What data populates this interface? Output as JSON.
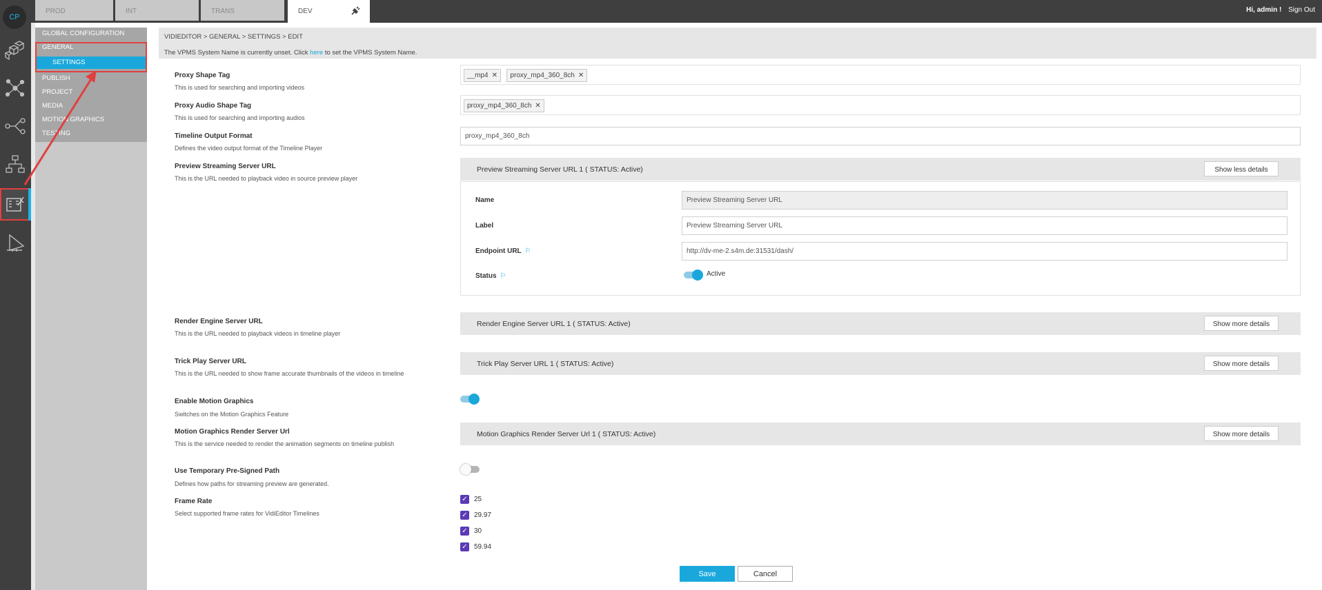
{
  "app": {
    "logo": "CP",
    "user_greeting": "Hi, admin !",
    "sign_out": "Sign Out"
  },
  "env_tabs": [
    {
      "label": "PROD"
    },
    {
      "label": "INT"
    },
    {
      "label": "TRANS"
    },
    {
      "label": "DEV",
      "icon": "plug-icon"
    }
  ],
  "rail_icons": [
    "cubes-icon",
    "network-icon",
    "workflow-icon",
    "hierarchy-icon",
    "vidieditor-icon",
    "ruler-icon"
  ],
  "nav": {
    "items": [
      {
        "label": "GLOBAL CONFIGURATION"
      },
      {
        "label": "GENERAL"
      },
      {
        "label": "SETTINGS"
      },
      {
        "label": "PUBLISH"
      },
      {
        "label": "PROJECT"
      },
      {
        "label": "MEDIA"
      },
      {
        "label": "MOTION GRAPHICS"
      },
      {
        "label": "TESTING"
      }
    ]
  },
  "breadcrumb": "VIDIEDITOR > GENERAL > SETTINGS > EDIT",
  "notice": {
    "before": "The VPMS System Name is currently unset. Click ",
    "link": "here",
    "after": " to set the VPMS System Name."
  },
  "fields": {
    "proxy_shape": {
      "label": "Proxy Shape Tag",
      "desc": "This is used for searching and importing videos",
      "tags": [
        "__mp4",
        "proxy_mp4_360_8ch"
      ]
    },
    "proxy_audio": {
      "label": "Proxy Audio Shape Tag",
      "desc": "This is used for searching and importing audios",
      "tags": [
        "proxy_mp4_360_8ch"
      ]
    },
    "timeline_output": {
      "label": "Timeline Output Format",
      "desc": "Defines the video output format of the Timeline Player",
      "value": "proxy_mp4_360_8ch"
    },
    "preview_stream": {
      "label": "Preview Streaming Server URL",
      "desc": "This is the URL needed to playback video in source preview player"
    },
    "render_engine": {
      "label": "Render Engine Server URL",
      "desc": "This is the URL needed to playback videos in timeline player"
    },
    "trick_play": {
      "label": "Trick Play Server URL",
      "desc": "This is the URL needed to show frame accurate thumbnails of the videos in timeline"
    },
    "motion_graphics": {
      "label": "Enable Motion Graphics",
      "desc": "Switches on the Motion Graphics Feature",
      "enabled": true
    },
    "mg_render": {
      "label": "Motion Graphics Render Server Url",
      "desc": "This is the service needed to render the animation segments on timeline publish"
    },
    "presigned": {
      "label": "Use Temporary Pre-Signed Path",
      "desc": "Defines how paths for streaming preview are generated.",
      "enabled": false
    },
    "frame_rate": {
      "label": "Frame Rate",
      "desc": "Select supported frame rates for VidiEditor Timelines",
      "options": [
        "25",
        "29.97",
        "30",
        "59.94"
      ]
    }
  },
  "groups": {
    "preview": {
      "title": "Preview Streaming Server URL 1 ( STATUS: Active)",
      "button": "Show less details",
      "name_label": "Name",
      "name_value": "Preview Streaming Server URL",
      "label_label": "Label",
      "label_value": "Preview Streaming Server URL",
      "endpoint_label": "Endpoint URL",
      "endpoint_value": "http://dv-me-2.s4m.de:31531/dash/",
      "status_label": "Status",
      "status_value": "Active"
    },
    "render": {
      "title": "Render Engine Server URL 1 ( STATUS: Active)",
      "button": "Show more details"
    },
    "trick": {
      "title": "Trick Play Server URL 1 ( STATUS: Active)",
      "button": "Show more details"
    },
    "mg": {
      "title": "Motion Graphics Render Server Url 1 ( STATUS: Active)",
      "button": "Show more details"
    }
  },
  "actions": {
    "save": "Save",
    "cancel": "Cancel"
  }
}
